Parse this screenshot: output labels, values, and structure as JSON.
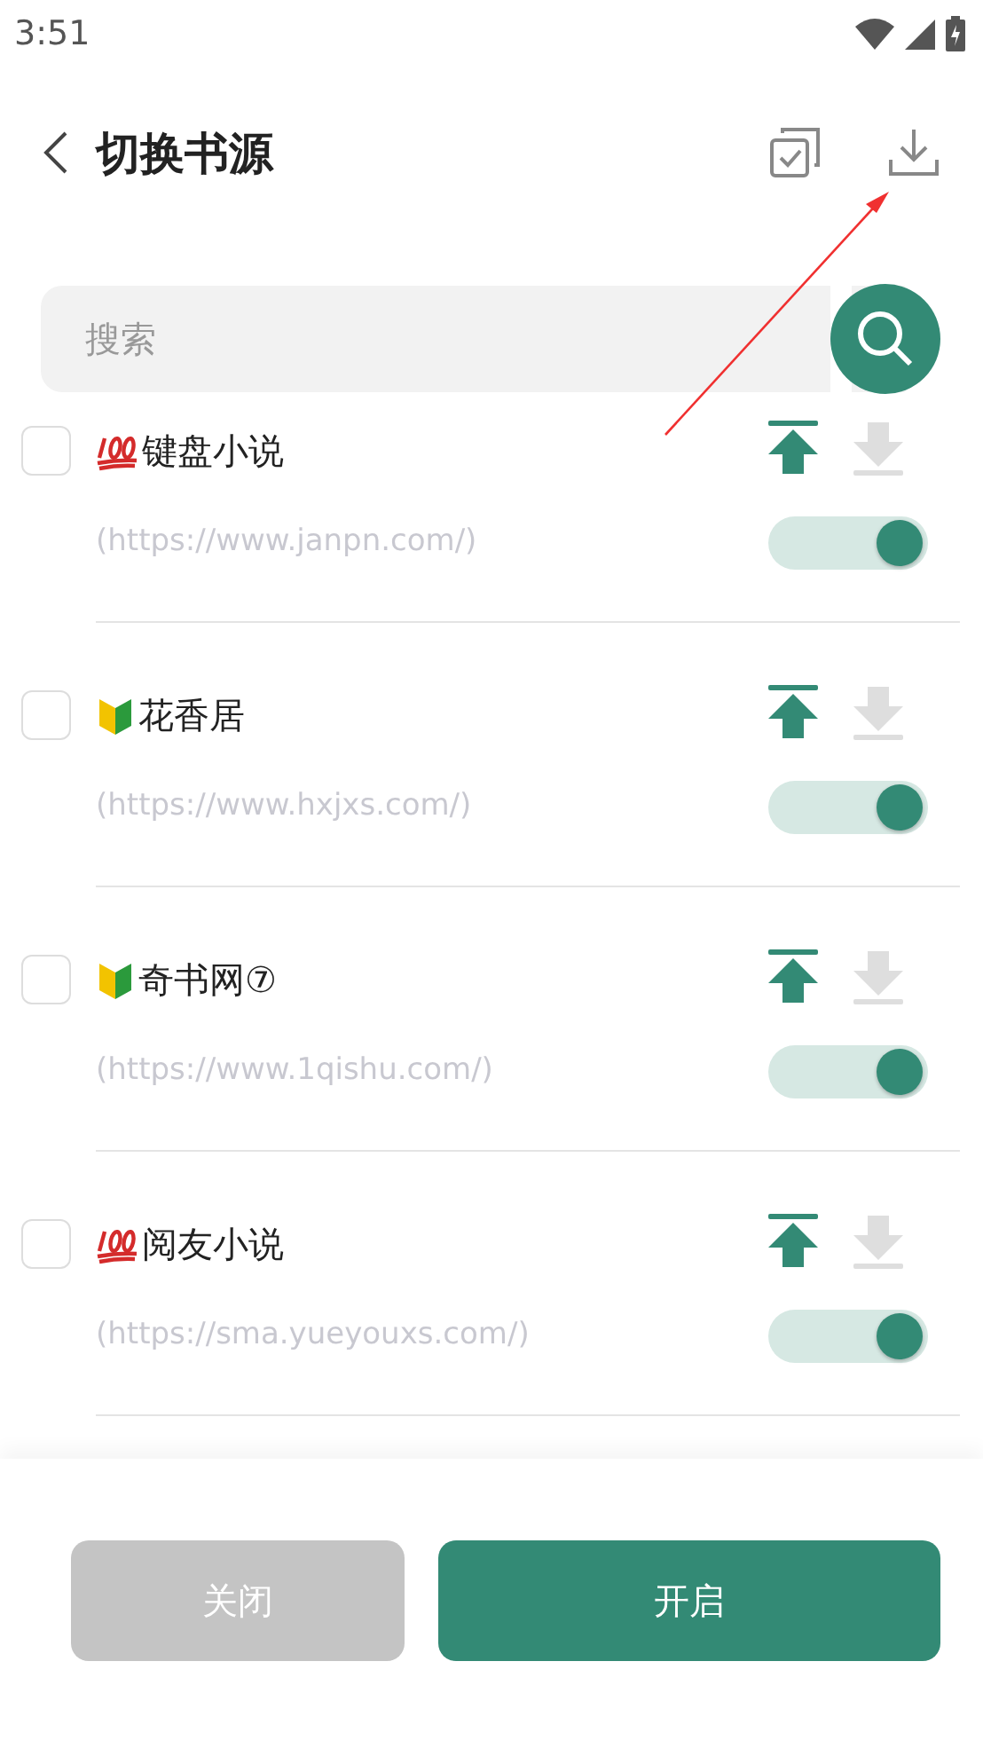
{
  "status_bar": {
    "time": "3:51"
  },
  "header": {
    "title": "切换书源"
  },
  "search": {
    "placeholder": "搜索"
  },
  "sources": [
    {
      "kind": "hundred",
      "name": "键盘小说",
      "url": "(https://www.janpn.com/)",
      "checked": false,
      "on": true
    },
    {
      "kind": "beginner",
      "name": "花香居",
      "url": "(https://www.hxjxs.com/)",
      "checked": false,
      "on": true
    },
    {
      "kind": "beginner",
      "name": "奇书网⑦",
      "url": "(https://www.1qishu.com/)",
      "checked": false,
      "on": true
    },
    {
      "kind": "hundred",
      "name": "阅友小说",
      "url": "(https://sma.yueyouxs.com/)",
      "checked": false,
      "on": true
    }
  ],
  "buttons": [
    {
      "label": "关闭",
      "kind": "secondary"
    },
    {
      "label": "开启",
      "kind": "primary"
    }
  ]
}
